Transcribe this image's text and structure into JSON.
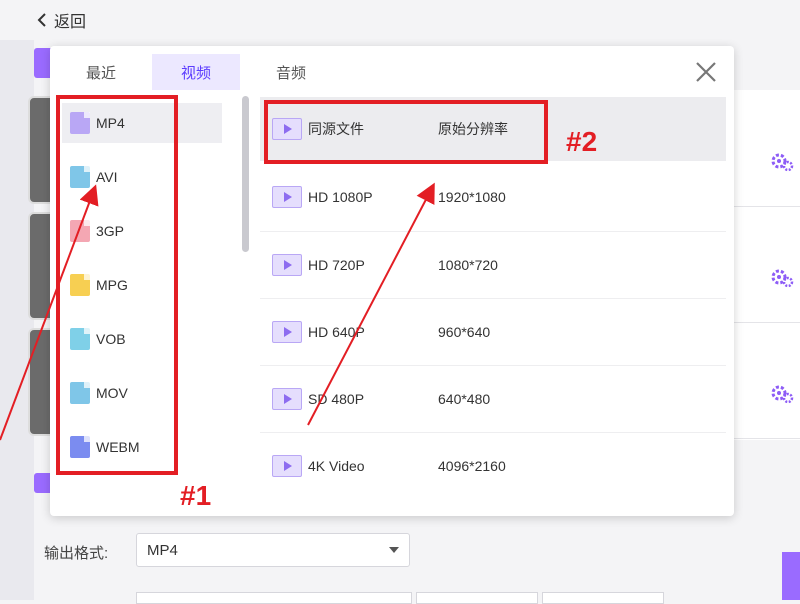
{
  "header": {
    "back_label": "返回"
  },
  "popup": {
    "tabs": [
      {
        "label": "最近",
        "active": false
      },
      {
        "label": "视频",
        "active": true
      },
      {
        "label": "音频",
        "active": false
      }
    ],
    "formats": [
      {
        "label": "MP4",
        "color": "#b9a7f5",
        "selected": true
      },
      {
        "label": "AVI",
        "color": "#7fc6e8",
        "selected": false
      },
      {
        "label": "3GP",
        "color": "#f4a7b3",
        "selected": false
      },
      {
        "label": "MPG",
        "color": "#f7cf52",
        "selected": false
      },
      {
        "label": "VOB",
        "color": "#7fd0e8",
        "selected": false
      },
      {
        "label": "MOV",
        "color": "#7fc6e8",
        "selected": false
      },
      {
        "label": "WEBM",
        "color": "#7b8cf0",
        "selected": false
      }
    ],
    "resolutions": [
      {
        "name": "同源文件",
        "dims": "原始分辨率",
        "selected": true
      },
      {
        "name": "HD 1080P",
        "dims": "1920*1080",
        "selected": false
      },
      {
        "name": "HD 720P",
        "dims": "1080*720",
        "selected": false
      },
      {
        "name": "HD 640P",
        "dims": "960*640",
        "selected": false
      },
      {
        "name": "SD 480P",
        "dims": "640*480",
        "selected": false
      },
      {
        "name": "4K Video",
        "dims": "4096*2160",
        "selected": false
      }
    ]
  },
  "output": {
    "label": "输出格式:",
    "value": "MP4"
  },
  "annotations": {
    "label1": "#1",
    "label2": "#2",
    "color": "#e31e24"
  },
  "colors": {
    "accent": "#9a6bff",
    "tab_active_bg": "#ece8ff",
    "tab_active_text": "#5c3cff"
  }
}
